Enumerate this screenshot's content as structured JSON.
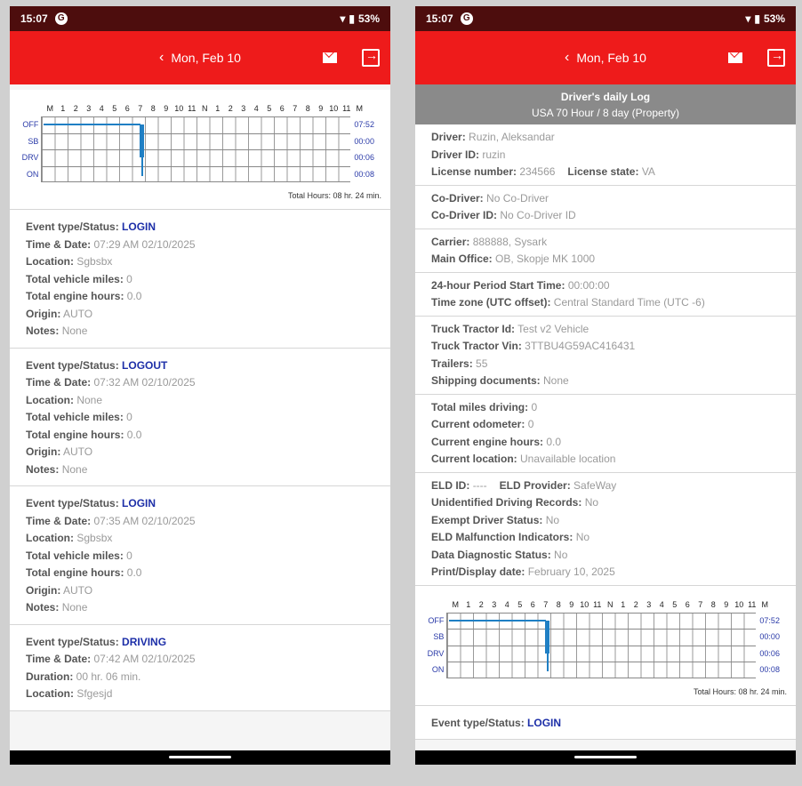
{
  "left": {
    "status": {
      "time": "15:07",
      "battery": "53%"
    },
    "appbar": {
      "date": "Mon, Feb 10"
    },
    "graph": {
      "hours": [
        "M",
        "1",
        "2",
        "3",
        "4",
        "5",
        "6",
        "7",
        "8",
        "9",
        "10",
        "11",
        "N",
        "1",
        "2",
        "3",
        "4",
        "5",
        "6",
        "7",
        "8",
        "9",
        "10",
        "11",
        "M"
      ],
      "rows": [
        {
          "label": "OFF",
          "total": "07:52"
        },
        {
          "label": "SB",
          "total": "00:00"
        },
        {
          "label": "DRV",
          "total": "00:06"
        },
        {
          "label": "ON",
          "total": "00:08"
        }
      ],
      "total_hours": "Total Hours: 08 hr. 24 min."
    },
    "events": [
      {
        "rows": [
          {
            "label": "Event type/Status:",
            "value": "LOGIN",
            "status": true
          },
          {
            "label": "Time & Date:",
            "value": "07:29 AM 02/10/2025"
          },
          {
            "label": "Location:",
            "value": "Sgbsbx"
          },
          {
            "label": "Total vehicle miles:",
            "value": "0"
          },
          {
            "label": "Total engine hours:",
            "value": "0.0"
          },
          {
            "label": "Origin:",
            "value": "AUTO"
          },
          {
            "label": "Notes:",
            "value": "None"
          }
        ]
      },
      {
        "rows": [
          {
            "label": "Event type/Status:",
            "value": "LOGOUT",
            "status": true
          },
          {
            "label": "Time & Date:",
            "value": "07:32 AM 02/10/2025"
          },
          {
            "label": "Location:",
            "value": "None"
          },
          {
            "label": "Total vehicle miles:",
            "value": "0"
          },
          {
            "label": "Total engine hours:",
            "value": "0.0"
          },
          {
            "label": "Origin:",
            "value": "AUTO"
          },
          {
            "label": "Notes:",
            "value": "None"
          }
        ]
      },
      {
        "rows": [
          {
            "label": "Event type/Status:",
            "value": "LOGIN",
            "status": true
          },
          {
            "label": "Time & Date:",
            "value": "07:35 AM 02/10/2025"
          },
          {
            "label": "Location:",
            "value": "Sgbsbx"
          },
          {
            "label": "Total vehicle miles:",
            "value": "0"
          },
          {
            "label": "Total engine hours:",
            "value": "0.0"
          },
          {
            "label": "Origin:",
            "value": "AUTO"
          },
          {
            "label": "Notes:",
            "value": "None"
          }
        ]
      },
      {
        "rows": [
          {
            "label": "Event type/Status:",
            "value": "DRIVING",
            "status": true
          },
          {
            "label": "Time & Date:",
            "value": "07:42 AM 02/10/2025"
          },
          {
            "label": "Duration:",
            "value": "00 hr. 06 min."
          },
          {
            "label": "Location:",
            "value": "Sfgesjd"
          }
        ]
      }
    ]
  },
  "right": {
    "status": {
      "time": "15:07",
      "battery": "53%"
    },
    "appbar": {
      "date": "Mon, Feb 10"
    },
    "log_header": {
      "title": "Driver's daily Log",
      "subtitle": "USA 70 Hour / 8 day (Property)"
    },
    "sections": [
      {
        "rows": [
          {
            "label": "Driver:",
            "value": "Ruzin, Aleksandar"
          },
          {
            "label": "Driver ID:",
            "value": "ruzin"
          }
        ],
        "pair": {
          "label1": "License number:",
          "value1": "234566",
          "label2": "License state:",
          "value2": "VA"
        }
      },
      {
        "rows": [
          {
            "label": "Co-Driver:",
            "value": "No Co-Driver"
          },
          {
            "label": "Co-Driver ID:",
            "value": "No Co-Driver ID"
          }
        ]
      },
      {
        "rows": [
          {
            "label": "Carrier:",
            "value": "888888, Sysark"
          },
          {
            "label": "Main Office:",
            "value": "OB, Skopje MK 1000"
          }
        ]
      },
      {
        "rows": [
          {
            "label": "24-hour Period Start Time:",
            "value": "00:00:00"
          },
          {
            "label": "Time zone (UTC offset):",
            "value": "Central Standard Time (UTC -6)"
          }
        ]
      },
      {
        "rows": [
          {
            "label": "Truck Tractor Id:",
            "value": "Test v2 Vehicle"
          },
          {
            "label": "Truck Tractor Vin:",
            "value": "3TTBU4G59AC416431"
          },
          {
            "label": "Trailers:",
            "value": "55"
          },
          {
            "label": "Shipping documents:",
            "value": "None"
          }
        ]
      },
      {
        "rows": [
          {
            "label": "Total miles driving:",
            "value": "0"
          },
          {
            "label": "Current odometer:",
            "value": "0"
          },
          {
            "label": "Current engine hours:",
            "value": "0.0"
          },
          {
            "label": "Current location:",
            "value": "Unavailable location"
          }
        ]
      },
      {
        "pair": {
          "label1": "ELD ID:",
          "value1": "----",
          "label2": "ELD Provider:",
          "value2": "SafeWay"
        },
        "rows_after": [
          {
            "label": "Unidentified Driving Records:",
            "value": "No"
          },
          {
            "label": "Exempt Driver Status:",
            "value": "No"
          },
          {
            "label": "ELD Malfunction Indicators:",
            "value": "No"
          },
          {
            "label": "Data Diagnostic Status:",
            "value": "No"
          },
          {
            "label": "Print/Display date:",
            "value": "February 10, 2025"
          }
        ]
      }
    ],
    "graph": {
      "hours": [
        "M",
        "1",
        "2",
        "3",
        "4",
        "5",
        "6",
        "7",
        "8",
        "9",
        "10",
        "11",
        "N",
        "1",
        "2",
        "3",
        "4",
        "5",
        "6",
        "7",
        "8",
        "9",
        "10",
        "11",
        "M"
      ],
      "rows": [
        {
          "label": "OFF",
          "total": "07:52"
        },
        {
          "label": "SB",
          "total": "00:00"
        },
        {
          "label": "DRV",
          "total": "00:06"
        },
        {
          "label": "ON",
          "total": "00:08"
        }
      ],
      "total_hours": "Total Hours: 08 hr. 24 min."
    },
    "next_event": {
      "label": "Event type/Status:",
      "value": "LOGIN"
    }
  },
  "colors": {
    "appbar": "#ee1b1b",
    "statusbar": "#4d0d0d",
    "status_text": "#1d2fa8",
    "graph_line": "#1f7fc4"
  }
}
